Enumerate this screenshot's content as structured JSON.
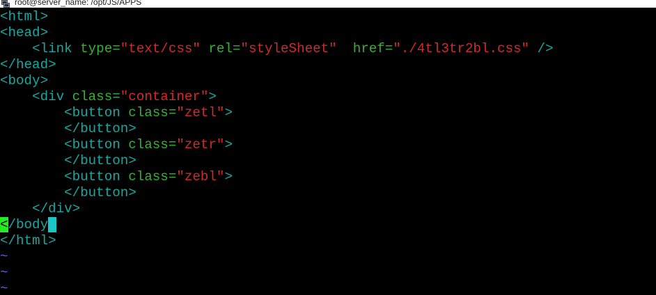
{
  "window": {
    "title": "root@server_name: /opt/JS/APPS"
  },
  "editor": {
    "lines": [
      [
        {
          "c": "tag",
          "t": "<html>"
        }
      ],
      [
        {
          "c": "tag",
          "t": "<head>"
        }
      ],
      [
        {
          "c": "plain",
          "t": "    "
        },
        {
          "c": "tag",
          "t": "<link "
        },
        {
          "c": "attr",
          "t": "type="
        },
        {
          "c": "str",
          "t": "\"text/css\""
        },
        {
          "c": "plain",
          "t": " "
        },
        {
          "c": "attr",
          "t": "rel="
        },
        {
          "c": "str",
          "t": "\"styleSheet\""
        },
        {
          "c": "plain",
          "t": "  "
        },
        {
          "c": "attr",
          "t": "href="
        },
        {
          "c": "str",
          "t": "\"./4tl3tr2bl.css\""
        },
        {
          "c": "plain",
          "t": " "
        },
        {
          "c": "tag",
          "t": "/>"
        }
      ],
      [
        {
          "c": "tag",
          "t": "</head>"
        }
      ],
      [
        {
          "c": "tag",
          "t": "<body>"
        }
      ],
      [
        {
          "c": "plain",
          "t": "    "
        },
        {
          "c": "tag",
          "t": "<div "
        },
        {
          "c": "attr",
          "t": "class="
        },
        {
          "c": "str",
          "t": "\"container\""
        },
        {
          "c": "tag",
          "t": ">"
        }
      ],
      [
        {
          "c": "plain",
          "t": "        "
        },
        {
          "c": "tag",
          "t": "<button "
        },
        {
          "c": "attr",
          "t": "class="
        },
        {
          "c": "str",
          "t": "\"zetl\""
        },
        {
          "c": "tag",
          "t": ">"
        }
      ],
      [
        {
          "c": "plain",
          "t": "        "
        },
        {
          "c": "tag",
          "t": "</button>"
        }
      ],
      [
        {
          "c": "plain",
          "t": "        "
        },
        {
          "c": "tag",
          "t": "<button "
        },
        {
          "c": "attr",
          "t": "class="
        },
        {
          "c": "str",
          "t": "\"zetr\""
        },
        {
          "c": "tag",
          "t": ">"
        }
      ],
      [
        {
          "c": "plain",
          "t": "        "
        },
        {
          "c": "tag",
          "t": "</button>"
        }
      ],
      [
        {
          "c": "plain",
          "t": "        "
        },
        {
          "c": "tag",
          "t": "<button "
        },
        {
          "c": "attr",
          "t": "class="
        },
        {
          "c": "str",
          "t": "\"zebl\""
        },
        {
          "c": "tag",
          "t": ">"
        }
      ],
      [
        {
          "c": "plain",
          "t": "        "
        },
        {
          "c": "tag",
          "t": "</button>"
        }
      ],
      [
        {
          "c": "plain",
          "t": "    "
        },
        {
          "c": "tag",
          "t": "</div>"
        }
      ],
      [
        {
          "c": "match",
          "t": "<"
        },
        {
          "c": "tag",
          "t": "/body"
        },
        {
          "c": "cursor",
          "t": ""
        }
      ],
      [
        {
          "c": "tag",
          "t": "</html>"
        }
      ],
      [
        {
          "c": "tilde",
          "t": "~"
        }
      ],
      [
        {
          "c": "tilde",
          "t": "~"
        }
      ],
      [
        {
          "c": "tilde",
          "t": "~"
        }
      ]
    ]
  },
  "colors": {
    "background": "#000000",
    "tag": "#14a9a3",
    "attribute": "#2fb62f",
    "string": "#d12a2a",
    "tilde": "#5c5cff",
    "match_highlight": "#22ee22",
    "cursor": "#19c7c7"
  },
  "icons": {
    "title_icon": "putty-terminal-icon"
  }
}
